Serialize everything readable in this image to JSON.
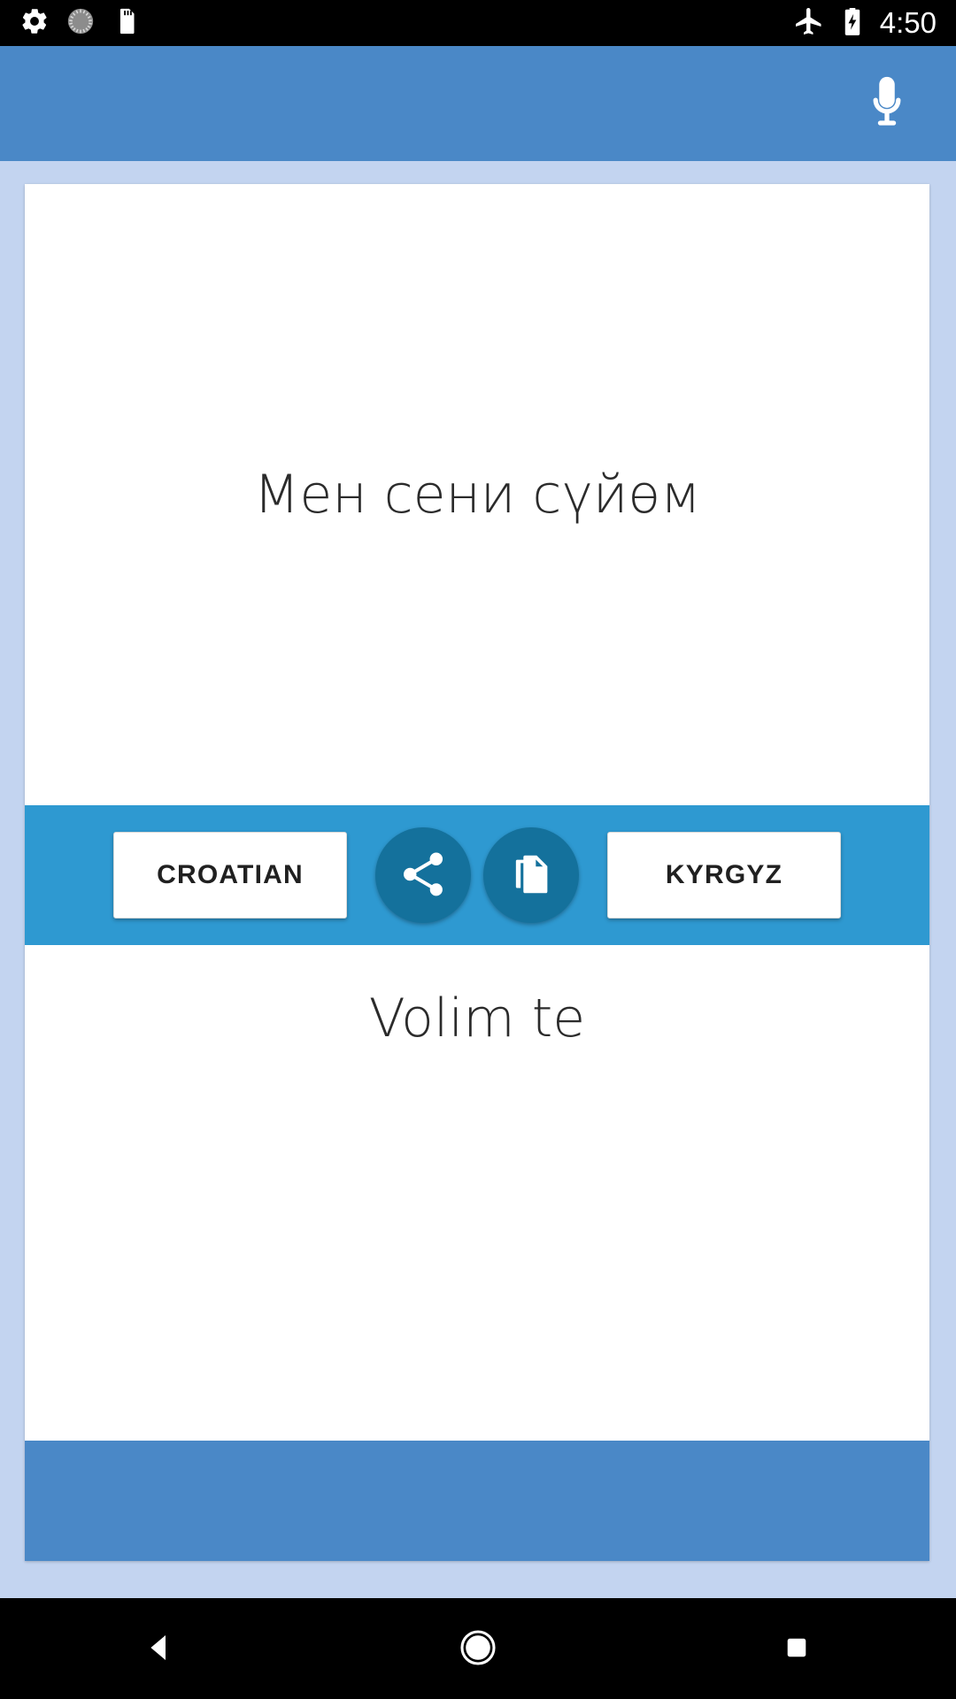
{
  "status_bar": {
    "icons": [
      "settings-gear-icon",
      "loading-spinner-icon",
      "sd-card-icon"
    ],
    "airplane_icon": "airplane-mode-icon",
    "battery_icon": "battery-charging-icon",
    "clock": "4:50"
  },
  "app_bar": {
    "mic_icon": "microphone-icon",
    "background_color": "#4a88c7"
  },
  "translator": {
    "source_text": "Мен сени сүйөм",
    "target_text": "Volim te",
    "left_language_label": "CROATIAN",
    "right_language_label": "KYRGYZ",
    "share_icon": "share-icon",
    "copy_icon": "copy-document-icon",
    "bar_color": "#2e99d1",
    "fab_color": "#14719c"
  },
  "nav_bar": {
    "back_icon": "back-triangle-icon",
    "home_icon": "home-circle-icon",
    "recents_icon": "recents-square-icon"
  }
}
